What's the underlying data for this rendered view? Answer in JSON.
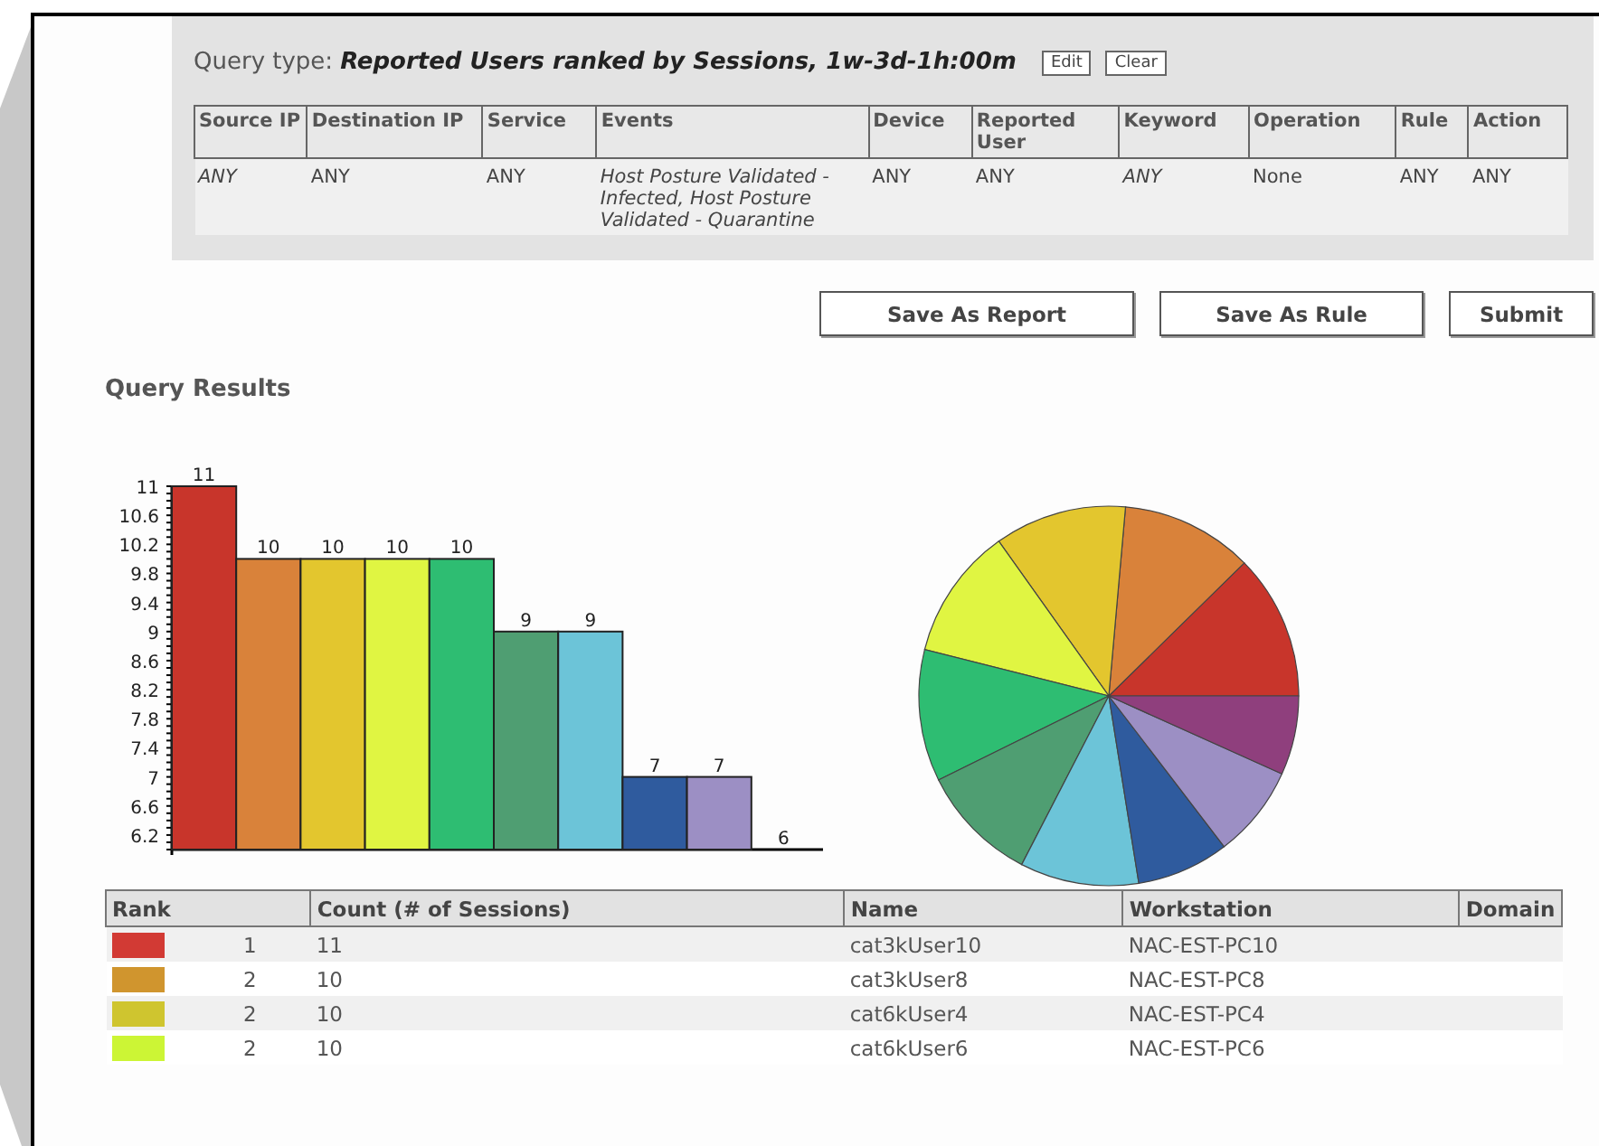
{
  "query": {
    "label": "Query type:",
    "value": "Reported Users ranked by Sessions, 1w-3d-1h:00m",
    "buttons": [
      "Edit",
      "Clear"
    ],
    "columns": [
      "Source IP",
      "Destination IP",
      "Service",
      "Events",
      "Device",
      "Reported User",
      "Keyword",
      "Operation",
      "Rule",
      "Action"
    ],
    "row": [
      {
        "text": "ANY",
        "italic": true
      },
      {
        "text": "ANY",
        "italic": false
      },
      {
        "text": "ANY",
        "italic": false
      },
      {
        "text": "Host Posture Validated - Infected, Host Posture Validated - Quarantine",
        "italic": true
      },
      {
        "text": "ANY",
        "italic": false
      },
      {
        "text": "ANY",
        "italic": false
      },
      {
        "text": "ANY",
        "italic": true
      },
      {
        "text": "None",
        "italic": false
      },
      {
        "text": "ANY",
        "italic": false
      },
      {
        "text": "ANY",
        "italic": false
      }
    ]
  },
  "actions": [
    "Save As Report",
    "Save As Rule",
    "Submit"
  ],
  "results_title": "Query Results",
  "chart_data": {
    "type": "bar",
    "ylim": [
      6,
      11
    ],
    "yticks": [
      6.2,
      6.6,
      7,
      7.4,
      7.8,
      8.2,
      8.6,
      9,
      9.4,
      9.8,
      10.2,
      10.6,
      11
    ],
    "data_labels": true,
    "colors": [
      "#c8352b",
      "#d9823a",
      "#e3c62e",
      "#e0f542",
      "#2ebd72",
      "#4f9e72",
      "#6cc4d8",
      "#2f5b9e",
      "#9c8fc4",
      "#8f3f7d"
    ],
    "values": [
      11,
      10,
      10,
      10,
      10,
      9,
      9,
      7,
      7,
      6
    ]
  },
  "results": {
    "columns": [
      "Rank",
      "Count (# of Sessions)",
      "Name",
      "Workstation",
      "Domain"
    ],
    "rows": [
      {
        "color": "#d23a34",
        "rank": "1",
        "count": "11",
        "name": "cat3kUser10",
        "workstation": "NAC-EST-PC10"
      },
      {
        "color": "#d0952e",
        "rank": "2",
        "count": "10",
        "name": "cat3kUser8",
        "workstation": "NAC-EST-PC8"
      },
      {
        "color": "#cfc52f",
        "rank": "2",
        "count": "10",
        "name": "cat6kUser4",
        "workstation": "NAC-EST-PC4"
      },
      {
        "color": "#ccf535",
        "rank": "2",
        "count": "10",
        "name": "cat6kUser6",
        "workstation": "NAC-EST-PC6"
      }
    ]
  }
}
